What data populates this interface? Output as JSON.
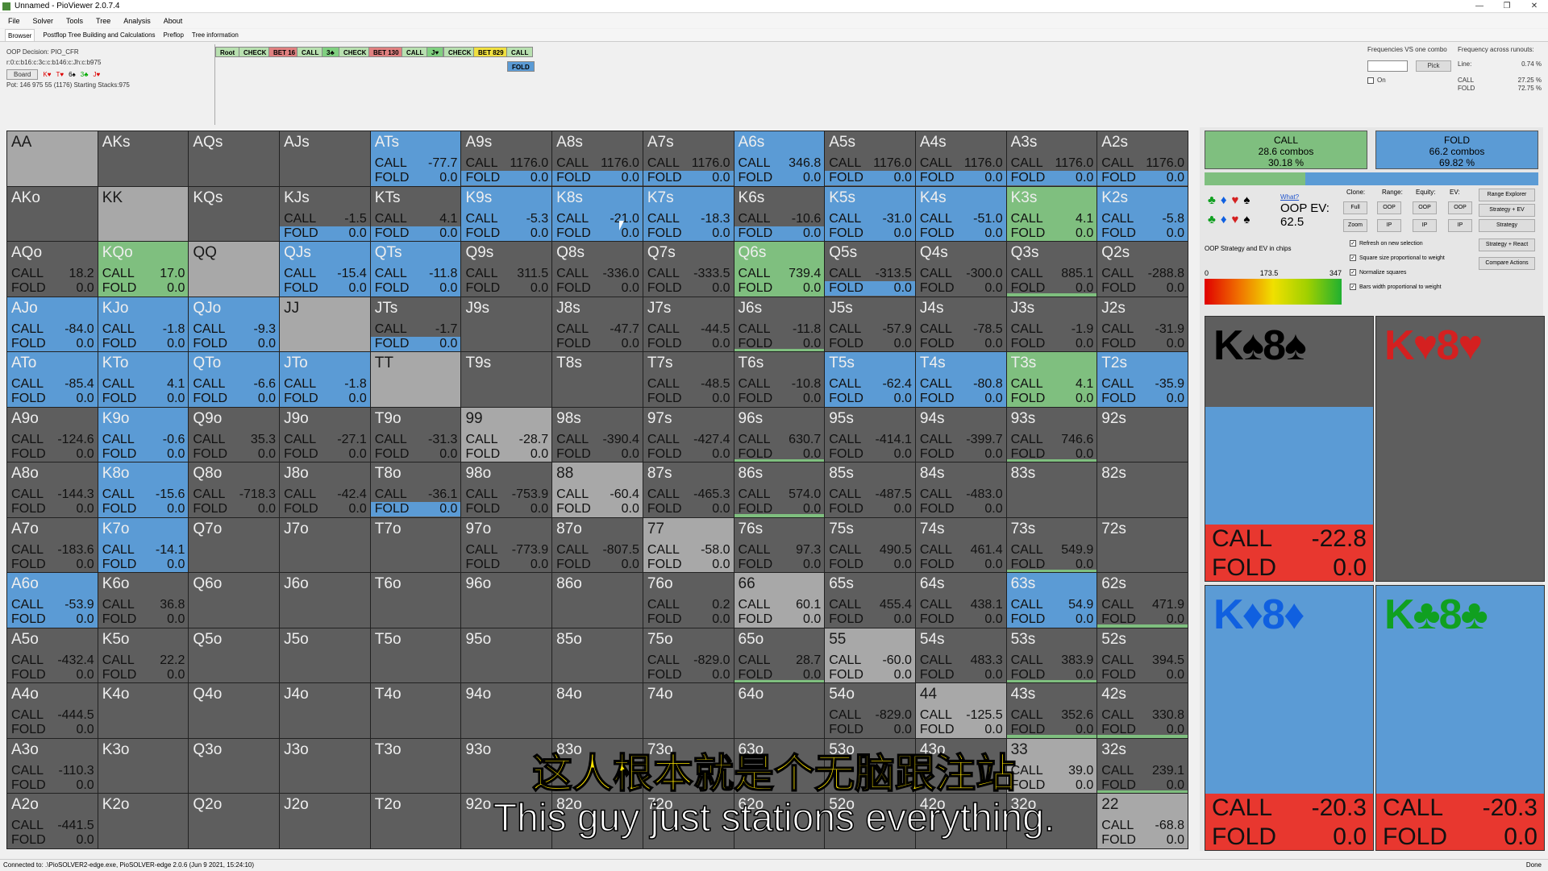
{
  "window": {
    "title": "Unnamed - PioViewer 2.0.7.4",
    "controls": [
      "—",
      "❐",
      "✕"
    ]
  },
  "menu": [
    "File",
    "Solver",
    "Tools",
    "Tree",
    "Analysis",
    "About"
  ],
  "tabs": [
    "Browser",
    "Postflop Tree Building and Calculations",
    "Preflop",
    "Tree information"
  ],
  "info": {
    "decision": "OOP Decision:  PIO_CFR",
    "line": "r:0:c:b16:c:3c:c:b146:c:Jh:c:b975",
    "board_label": "Board",
    "board_cards": [
      {
        "t": "K♥",
        "c": "r"
      },
      {
        "t": "T♥",
        "c": "r"
      },
      {
        "t": "6♠",
        "c": "b"
      },
      {
        "t": "3♣",
        "c": "g"
      },
      {
        "t": "J♥",
        "c": "r"
      }
    ],
    "pot": "Pot: 146 975 55 (1176) Starting Stacks:975"
  },
  "tree": [
    {
      "label": "Root",
      "color": "#b8e0b0"
    },
    {
      "label": "CHECK",
      "color": "#b8e0b0"
    },
    {
      "label": "BET 16",
      "color": "#e08080"
    },
    {
      "label": "CALL",
      "color": "#b8e0b0"
    },
    {
      "label": "3♣",
      "color": "#80d080"
    },
    {
      "label": "CHECK",
      "color": "#b8e0b0"
    },
    {
      "label": "BET 130",
      "color": "#e08080"
    },
    {
      "label": "CALL",
      "color": "#b8e0b0"
    },
    {
      "label": "J♥",
      "color": "#80d080"
    },
    {
      "label": "CHECK",
      "color": "#b8e0b0"
    },
    {
      "label": "BET 829",
      "color": "#f0e040"
    },
    {
      "label": "CALL",
      "color": "#b8e0b0"
    },
    {
      "label": "FOLD",
      "color": "#5b9bd5"
    }
  ],
  "freq": {
    "vs_combo": "Frequencies VS one combo",
    "pick": "Pick",
    "on": "On",
    "across": "Frequency across runouts:",
    "line_label": "Line:",
    "line_val": "0.74 %",
    "call_label": "CALL",
    "call_val": "27.25 %",
    "fold_label": "FOLD",
    "fold_val": "72.75 %"
  },
  "summary": {
    "call_label": "CALL",
    "call_combos": "28.6 combos",
    "call_pct": "30.18 %",
    "fold_label": "FOLD",
    "fold_combos": "66.2 combos",
    "fold_pct": "69.82 %",
    "call_frac": 0.3018
  },
  "controls": {
    "what": "What?",
    "oop_ev_label": "OOP EV:",
    "oop_ev": "62.5",
    "clone": "Clone:",
    "range": "Range:",
    "equity": "Equity:",
    "ev": "EV:",
    "full": "Full",
    "zoom": "Zoom",
    "oop": "OOP",
    "ip": "IP",
    "range_explorer": "Range Explorer",
    "strategy_ev": "Strategy + EV",
    "strategy": "Strategy",
    "strategy_react": "Strategy + React",
    "compare": "Compare Actions",
    "chips_label": "OOP Strategy and EV in chips",
    "g0": "0",
    "g1": "173.5",
    "g2": "347",
    "chk1": "Refresh on new selection",
    "chk2": "Square size proportional to weight",
    "chk3": "Normalize squares",
    "chk4": "Bars width proportional to weight"
  },
  "combos": [
    {
      "cards": "K♠8♠",
      "color": "#000",
      "blue": 0.6,
      "call": "-22.8",
      "fold": "0.0",
      "call_label": "CALL",
      "fold_label": "FOLD",
      "show": true
    },
    {
      "cards": "K♥8♥",
      "color": "#d42020",
      "blue": 0,
      "call": "",
      "fold": "",
      "call_label": "",
      "fold_label": "",
      "show": false
    },
    {
      "cards": "K♦8♦",
      "color": "#1060e0",
      "blue": 1,
      "call": "-20.3",
      "fold": "0.0",
      "call_label": "CALL",
      "fold_label": "FOLD",
      "show": true
    },
    {
      "cards": "K♣8♣",
      "color": "#10a020",
      "blue": 1,
      "call": "-20.3",
      "fold": "0.0",
      "call_label": "CALL",
      "fold_label": "FOLD",
      "show": true
    }
  ],
  "status": {
    "left": "Connected to: .\\PioSOLVER2-edge.exe, PioSOLVER-edge 2.0.6 (Jun  9 2021, 15:24:10)",
    "right": "Done"
  },
  "subtitle": {
    "cn": "这人根本就是个无脑跟注站",
    "en": "This guy just stations everything."
  },
  "grid": [
    [
      "AA||",
      "AKs||",
      "AQs||",
      "AJs||",
      "ATs|-77.7|0.0",
      "A9s|1176.0|0.0",
      "A8s|1176.0|0.0",
      "A7s|1176.0|0.0",
      "A6s|346.8|0.0",
      "A5s|1176.0|0.0",
      "A4s|1176.0|0.0",
      "A3s|1176.0|0.0",
      "A2s|1176.0|0.0"
    ],
    [
      "AKo||",
      "KK||",
      "KQs||",
      "KJs|-1.5|0.0",
      "KTs|4.1|0.0",
      "K9s|-5.3|0.0",
      "K8s|-21.0|0.0",
      "K7s|-18.3|0.0",
      "K6s|-10.6|0.0",
      "K5s|-31.0|0.0",
      "K4s|-51.0|0.0",
      "K3s|4.1|0.0",
      "K2s|-5.8|0.0"
    ],
    [
      "AQo|18.2|0.0",
      "KQo|17.0|0.0",
      "QQ||",
      "QJs|-15.4|0.0",
      "QTs|-11.8|0.0",
      "Q9s|311.5|0.0",
      "Q8s|-336.0|0.0",
      "Q7s|-333.5|0.0",
      "Q6s|739.4|0.0",
      "Q5s|-313.5|0.0",
      "Q4s|-300.0|0.0",
      "Q3s|885.1|0.0",
      "Q2s|-288.8|0.0"
    ],
    [
      "AJo|-84.0|0.0",
      "KJo|-1.8|0.0",
      "QJo|-9.3|0.0",
      "JJ||",
      "JTs|-1.7|0.0",
      "J9s||",
      "J8s|-47.7|0.0",
      "J7s|-44.5|0.0",
      "J6s|-11.8|0.0",
      "J5s|-57.9|0.0",
      "J4s|-78.5|0.0",
      "J3s|-1.9|0.0",
      "J2s|-31.9|0.0"
    ],
    [
      "ATo|-85.4|0.0",
      "KTo|4.1|0.0",
      "QTo|-6.6|0.0",
      "JTo|-1.8|0.0",
      "TT||",
      "T9s||",
      "T8s||",
      "T7s|-48.5|0.0",
      "T6s|-10.8|0.0",
      "T5s|-62.4|0.0",
      "T4s|-80.8|0.0",
      "T3s|4.1|0.0",
      "T2s|-35.9|0.0"
    ],
    [
      "A9o|-124.6|0.0",
      "K9o|-0.6|0.0",
      "Q9o|35.3|0.0",
      "J9o|-27.1|0.0",
      "T9o|-31.3|0.0",
      "99|-28.7|0.0",
      "98s|-390.4|0.0",
      "97s|-427.4|0.0",
      "96s|630.7|0.0",
      "95s|-414.1|0.0",
      "94s|-399.7|0.0",
      "93s|746.6|0.0",
      "92s||"
    ],
    [
      "A8o|-144.3|0.0",
      "K8o|-15.6|0.0",
      "Q8o|-718.3|0.0",
      "J8o|-42.4|0.0",
      "T8o|-36.1|0.0",
      "98o|-753.9|0.0",
      "88|-60.4|0.0",
      "87s|-465.3|0.0",
      "86s|574.0|0.0",
      "85s|-487.5|0.0",
      "84s|-483.0|0.0",
      "83s||",
      "82s||"
    ],
    [
      "A7o|-183.6|0.0",
      "K7o|-14.1|0.0",
      "Q7o||",
      "J7o||",
      "T7o||",
      "97o|-773.9|0.0",
      "87o|-807.5|0.0",
      "77|-58.0|0.0",
      "76s|97.3|0.0",
      "75s|490.5|0.0",
      "74s|461.4|0.0",
      "73s|549.9|0.0",
      "72s||"
    ],
    [
      "A6o|-53.9|0.0",
      "K6o|36.8|0.0",
      "Q6o||",
      "J6o||",
      "T6o||",
      "96o||",
      "86o||",
      "76o|0.2|0.0",
      "66|60.1|0.0",
      "65s|455.4|0.0",
      "64s|438.1|0.0",
      "63s|54.9|0.0",
      "62s|471.9|0.0"
    ],
    [
      "A5o|-432.4|0.0",
      "K5o|22.2|0.0",
      "Q5o||",
      "J5o||",
      "T5o||",
      "95o||",
      "85o||",
      "75o|-829.0|0.0",
      "65o|28.7|0.0",
      "55|-60.0|0.0",
      "54s|483.3|0.0",
      "53s|383.9|0.0",
      "52s|394.5|0.0"
    ],
    [
      "A4o|-444.5|0.0",
      "K4o||",
      "Q4o||",
      "J4o||",
      "T4o||",
      "94o||",
      "84o||",
      "74o||",
      "64o||",
      "54o|-829.0|0.0",
      "44|-125.5|0.0",
      "43s|352.6|0.0",
      "42s|330.8|0.0"
    ],
    [
      "A3o|-110.3|0.0",
      "K3o||",
      "Q3o||",
      "J3o||",
      "T3o||",
      "93o||",
      "83o||",
      "73o||",
      "63o||",
      "53o||",
      "43o||",
      "33|39.0|0.0",
      "32s|239.1|0.0"
    ],
    [
      "A2o|-441.5|0.0",
      "K2o||",
      "Q2o||",
      "J2o||",
      "T2o||",
      "92o||",
      "82o||",
      "72o||",
      "62o||",
      "52o||",
      "42o||",
      "32o||",
      "22|-68.8|0.0"
    ]
  ],
  "fills": {
    "blue_full": [
      "ATs",
      "A6s",
      "K9s",
      "K8s",
      "K7s",
      "K5s",
      "K4s",
      "K2s",
      "QJs",
      "QTs",
      "AJo",
      "KJo",
      "QJo",
      "ATo",
      "KTo",
      "QTo",
      "JTo",
      "T5s",
      "T4s",
      "T2s",
      "K9o",
      "K8o",
      "K7o",
      "A6o",
      "63s"
    ],
    "green_full": [
      "K3s",
      "T3s",
      "KQo",
      "Q6s"
    ],
    "blue_fold": [
      "A9s",
      "A8s",
      "A7s",
      "A5s",
      "A4s",
      "A3s",
      "A2s",
      "KTs",
      "KJs",
      "K6s",
      "Q5s",
      "JTs",
      "T8o"
    ],
    "green_fold": [
      "Q3s",
      "96s",
      "93s",
      "86s",
      "73s",
      "53s",
      "43s",
      "32s",
      "42s",
      "62s",
      "65o",
      "J6s"
    ]
  }
}
